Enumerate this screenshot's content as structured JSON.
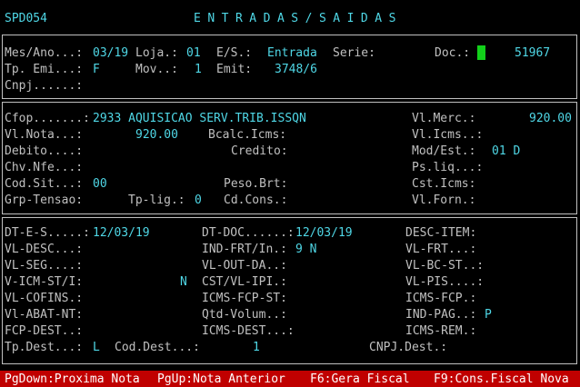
{
  "header": {
    "code": "SPD054",
    "title": "ENTRADAS/SAIDAS"
  },
  "section1": {
    "mes_ano_label": "Mes/Ano...:",
    "mes_ano": "03/19",
    "loja_label": "Loja.:",
    "loja": "01",
    "es_label": "E/S.:",
    "es": "Entrada",
    "serie_label": "Serie:",
    "serie": "",
    "doc_label": "Doc.:",
    "doc": "51967",
    "tp_emi_label": "Tp. Emi...:",
    "tp_emi": "F",
    "mov_label": "Mov..:",
    "mov": "1",
    "emit_label": "Emit:",
    "emit": "3748/6",
    "cnpj_label": "Cnpj......:",
    "cnpj": ""
  },
  "section2": {
    "cfop_label": "Cfop.......:",
    "cfop": "2933 AQUISICAO SERV.TRIB.ISSQN",
    "vl_merc_label": "Vl.Merc.:",
    "vl_merc": "920.00",
    "vl_nota_label": "Vl.Nota...:",
    "vl_nota": "920.00",
    "bcalc_icms_label": "Bcalc.Icms:",
    "bcalc_icms": "",
    "vl_icms_label": "Vl.Icms..:",
    "vl_icms": "",
    "debito_label": "Debito....:",
    "debito": "",
    "credito_label": "Credito:",
    "credito": "",
    "mod_est_label": "Mod/Est.:",
    "mod_est": "01 D",
    "chv_nfe_label": "Chv.Nfe...:",
    "chv_nfe": "",
    "ps_liq_label": "Ps.liq...:",
    "ps_liq": "",
    "cod_sit_label": "Cod.Sit...:",
    "cod_sit": "00",
    "peso_brt_label": "Peso.Brt:",
    "peso_brt": "",
    "cst_icms_label": "Cst.Icms:",
    "cst_icms": "",
    "grp_tensao_label": "Grp-Tensao:",
    "grp_tensao": "",
    "tp_lig_label": "Tp-lig.:",
    "tp_lig": "0",
    "cd_cons_label": "Cd.Cons.:",
    "cd_cons": "",
    "vl_forn_label": "Vl.Forn.:",
    "vl_forn": ""
  },
  "section3": {
    "dt_e_s_label": "DT-E-S.....:",
    "dt_e_s": "12/03/19",
    "dt_doc_label": "DT-DOC......:",
    "dt_doc": "12/03/19",
    "desc_item_label": "DESC-ITEM:",
    "vl_desc_label": "VL-DESC...:",
    "ind_frt_label": "IND-FRT/In.:",
    "ind_frt": "9 N",
    "vl_frt_label": "VL-FRT...:",
    "vl_seg_label": "VL-SEG....:",
    "vl_out_da_label": "VL-OUT-DA..:",
    "vl_bc_st_label": "VL-BC-ST..:",
    "v_icm_st_label": "V-ICM-ST/I:",
    "v_icm_st": "N",
    "cst_vl_ipi_label": "CST/VL-IPI.:",
    "vl_pis_label": "VL-PIS....:",
    "vl_cofins_label": "VL-COFINS.:",
    "icms_fcp_st_label": "ICMS-FCP-ST:",
    "icms_fcp_label": "ICMS-FCP.:",
    "vl_abat_nt_label": "Vl-ABAT-NT:",
    "qtd_volum_label": "Qtd-Volum..:",
    "ind_pag_label": "IND-PAG..:",
    "ind_pag": "P",
    "fcp_dest_label": "FCP-DEST..:",
    "icms_dest_label": "ICMS-DEST...:",
    "icms_rem_label": "ICMS-REM.:",
    "tp_dest_label": "Tp.Dest...:",
    "tp_dest": "L",
    "cod_dest_label": "Cod.Dest...:",
    "cod_dest": "1",
    "cnpj_dest_label": "CNPJ.Dest.:"
  },
  "footer": {
    "pgdown": "PgDown:Proxima Nota",
    "pgup": "PgUp:Nota Anterior",
    "f6": "F6:Gera Fiscal",
    "f9": "F9:Cons.Fiscal Nova"
  },
  "colors": {
    "value": "#4fd7e6",
    "label": "#c0c0c0",
    "cursor": "#12d01a",
    "footer": "#c00000"
  }
}
